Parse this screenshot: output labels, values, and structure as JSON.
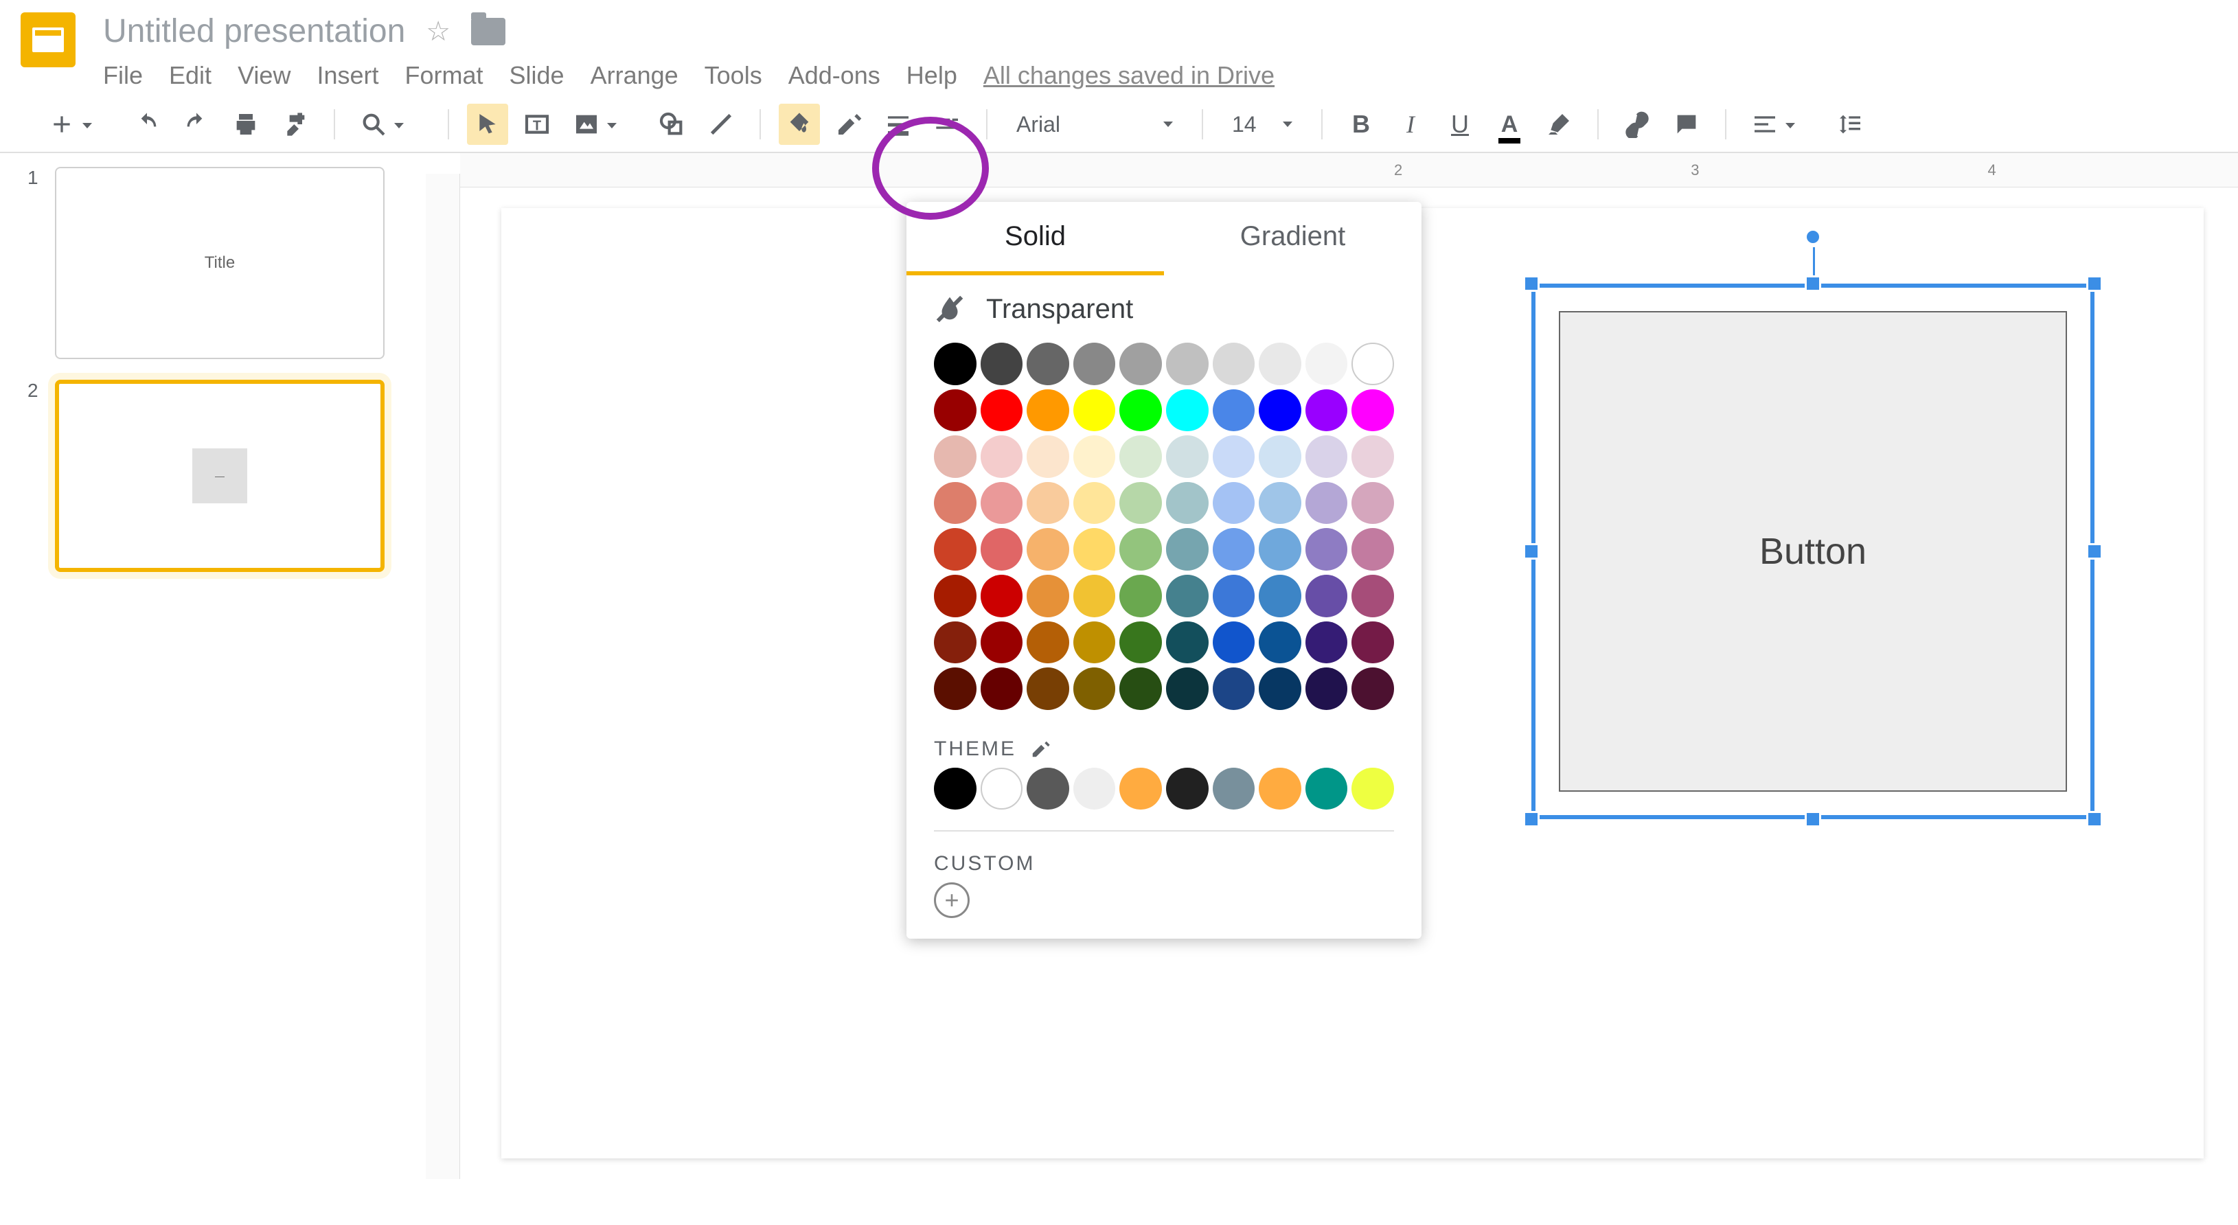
{
  "doc": {
    "title": "Untitled presentation",
    "save_status": "All changes saved in Drive"
  },
  "menu": {
    "file": "File",
    "edit": "Edit",
    "view": "View",
    "insert": "Insert",
    "format": "Format",
    "slide": "Slide",
    "arrange": "Arrange",
    "tools": "Tools",
    "addons": "Add-ons",
    "help": "Help"
  },
  "toolbar": {
    "font": "Arial",
    "size": "14"
  },
  "ruler": {
    "marks": [
      "2",
      "3",
      "4"
    ]
  },
  "thumbs": [
    {
      "num": "1",
      "label": "Title"
    },
    {
      "num": "2",
      "label": ""
    }
  ],
  "canvas": {
    "shape_text": "Button"
  },
  "popover": {
    "tab_solid": "Solid",
    "tab_gradient": "Gradient",
    "transparent": "Transparent",
    "theme": "THEME",
    "custom": "CUSTOM",
    "colors": [
      "#000000",
      "#434343",
      "#666666",
      "#888888",
      "#a0a0a0",
      "#c0c0c0",
      "#d9d9d9",
      "#e8e8e8",
      "#f3f3f3",
      "#ffffff",
      "#980000",
      "#ff0000",
      "#ff9900",
      "#ffff00",
      "#00ff00",
      "#00ffff",
      "#4a86e8",
      "#0000ff",
      "#9900ff",
      "#ff00ff",
      "#e6b8af",
      "#f4cccc",
      "#fce5cd",
      "#fff2cc",
      "#d9ead3",
      "#d0e0e3",
      "#c9daf8",
      "#cfe2f3",
      "#d9d2e9",
      "#ead1dc",
      "#dd7e6b",
      "#ea9999",
      "#f9cb9c",
      "#ffe599",
      "#b6d7a8",
      "#a2c4c9",
      "#a4c2f4",
      "#9fc5e8",
      "#b4a7d6",
      "#d5a6bd",
      "#cc4125",
      "#e06666",
      "#f6b26b",
      "#ffd966",
      "#93c47d",
      "#76a5af",
      "#6d9eeb",
      "#6fa8dc",
      "#8e7cc3",
      "#c27ba0",
      "#a61c00",
      "#cc0000",
      "#e69138",
      "#f1c232",
      "#6aa84f",
      "#45818e",
      "#3c78d8",
      "#3d85c6",
      "#674ea7",
      "#a64d79",
      "#85200c",
      "#990000",
      "#b45f06",
      "#bf9000",
      "#38761d",
      "#134f5c",
      "#1155cc",
      "#0b5394",
      "#351c75",
      "#741b47",
      "#5b0f00",
      "#660000",
      "#783f04",
      "#7f6000",
      "#274e13",
      "#0c343d",
      "#1c4587",
      "#073763",
      "#20124d",
      "#4c1130"
    ],
    "theme_colors": [
      "#000000",
      "#ffffff",
      "#595959",
      "#eeeeee",
      "#ffab40",
      "#212121",
      "#78909c",
      "#ffab40",
      "#009688",
      "#eeff41"
    ]
  }
}
